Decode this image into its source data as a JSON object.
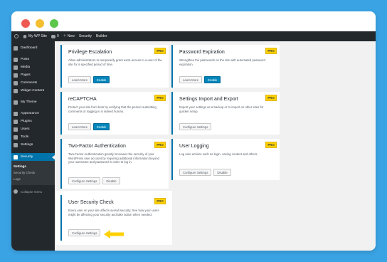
{
  "adminbar": {
    "site": "My WP Site",
    "comments": "0",
    "new": "New",
    "security": "Security",
    "builder": "Builder"
  },
  "sidebar": {
    "items": [
      {
        "label": "Dashboard",
        "icon": "dashboard-icon"
      },
      {
        "label": "Posts",
        "icon": "pin-icon"
      },
      {
        "label": "Media",
        "icon": "media-icon"
      },
      {
        "label": "Pages",
        "icon": "page-icon"
      },
      {
        "label": "Comments",
        "icon": "comment-icon"
      },
      {
        "label": "Widget Content",
        "icon": "pin-icon"
      },
      {
        "label": "My Theme",
        "icon": "theme-icon"
      },
      {
        "label": "Appearance",
        "icon": "brush-icon"
      },
      {
        "label": "Plugins",
        "icon": "plugin-icon"
      },
      {
        "label": "Users",
        "icon": "user-icon"
      },
      {
        "label": "Tools",
        "icon": "wrench-icon"
      },
      {
        "label": "Settings",
        "icon": "settings-icon"
      },
      {
        "label": "Security",
        "icon": "shield-icon"
      }
    ],
    "submenu": [
      "Settings",
      "Security Check",
      "Logs"
    ],
    "collapse": "Collapse menu"
  },
  "badge": "PRO",
  "cards": {
    "privilege": {
      "title": "Privilege Escalation",
      "desc": "Allow administrators to temporarily grant extra access to a user of the site for a specified period of time.",
      "btn1": "Learn More",
      "btn2": "Enable"
    },
    "password": {
      "title": "Password Expiration",
      "desc": "Strengthen the passwords on the site with automated password expiration.",
      "btn1": "Learn More",
      "btn2": "Enable"
    },
    "recaptcha": {
      "title": "reCAPTCHA",
      "desc": "Protect your site from bots by verifying that the person submitting comments or logging in is indeed human.",
      "btn1": "Learn More",
      "btn2": "Enable"
    },
    "import": {
      "title": "Settings Import and Export",
      "desc": "Export your settings as a backup or to import on other sites for quicker setup.",
      "btn1": "Configure Settings"
    },
    "twofactor": {
      "title": "Two-Factor Authentication",
      "desc": "Two-Factor Authentication greatly increases the security of your WordPress user account by requiring additional information beyond your username and password in order to log in.",
      "btn1": "Configure Settings",
      "btn2": "Disable"
    },
    "logging": {
      "title": "User Logging",
      "desc": "Log user actions such as login, saving content and others.",
      "btn1": "Configure Settings",
      "btn2": "Disable"
    },
    "check": {
      "title": "User Security Check",
      "desc": "Every user on your site affects overall security. See how your users might be affecting your security and take action when needed.",
      "btn1": "Configure Settings"
    }
  },
  "colors": {
    "background": "#3aa3e3",
    "admin_dark": "#23282d",
    "accent": "#0073aa",
    "pro_badge": "#ffd100",
    "arrow": "#ffd100"
  }
}
